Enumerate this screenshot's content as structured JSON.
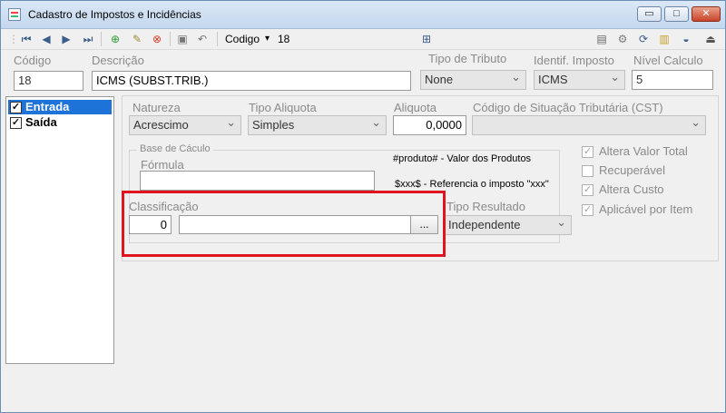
{
  "window": {
    "title": "Cadastro de Impostos e Incidências",
    "min_glyph": "▭",
    "max_glyph": "□",
    "close_glyph": "✕"
  },
  "toolbar": {
    "codigo_label": "Codigo",
    "codigo_arrow": "▾",
    "codigo_value": "18"
  },
  "header": {
    "codigo_label": "Código",
    "codigo_value": "18",
    "descricao_label": "Descrição",
    "descricao_value": "ICMS (SUBST.TRIB.)",
    "tipo_tributo_label": "Tipo de Tributo",
    "tipo_tributo_value": "None",
    "identif_imposto_label": "Identif. Imposto",
    "identif_imposto_value": "ICMS",
    "nivel_calculo_label": "Nível Calculo",
    "nivel_calculo_value": "5"
  },
  "list": {
    "items": [
      {
        "label": "Entrada",
        "checked": "✓"
      },
      {
        "label": "Saída",
        "checked": "✓"
      }
    ]
  },
  "details": {
    "natureza_label": "Natureza",
    "natureza_value": "Acrescimo",
    "tipo_aliquota_label": "Tipo Aliquota",
    "tipo_aliquota_value": "Simples",
    "aliquota_label": "Aliquota",
    "aliquota_value": "0,0000",
    "cst_label": "Código de Situação Tributária (CST)",
    "cst_value": "",
    "base_calculo_title": "Base de Cáculo",
    "formula_label": "Fórmula",
    "formula_value": "",
    "note_produto": "#produto# - Valor dos Produtos",
    "note_xxx": "$xxx$ - Referencia o imposto \"xxx\"",
    "classificacao_label": "Classificação",
    "classificacao_code": "0",
    "classificacao_desc": "",
    "ellipsis_label": "...",
    "tipo_resultado_label": "Tipo Resultado",
    "tipo_resultado_value": "Independente"
  },
  "options": {
    "altera_valor_total": {
      "label": "Altera Valor Total",
      "mark": "✓"
    },
    "recuperavel": {
      "label": "Recuperável",
      "mark": ""
    },
    "altera_custo": {
      "label": "Altera Custo",
      "mark": "✓"
    },
    "aplicavel_por_item": {
      "label": "Aplicável por Item",
      "mark": "✓"
    }
  },
  "colors": {
    "highlight": "#e0141e",
    "selection": "#1e73d8"
  }
}
